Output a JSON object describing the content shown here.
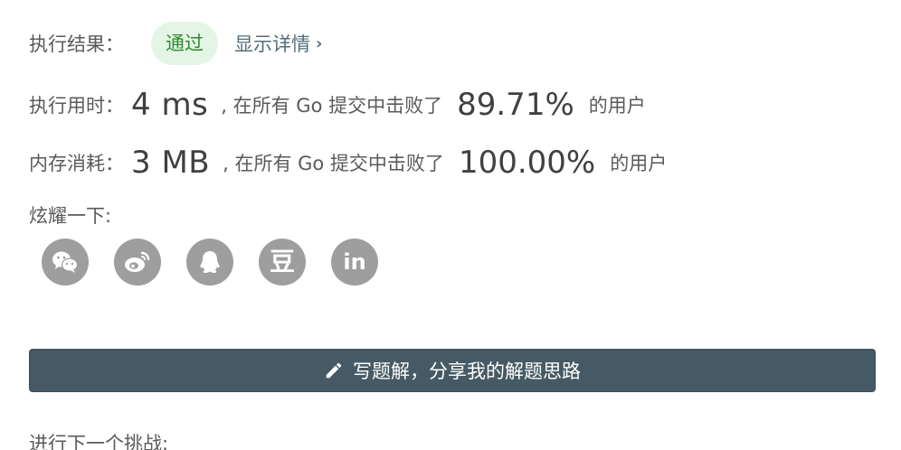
{
  "result": {
    "label": "执行结果：",
    "status": "通过",
    "details_link": "显示详情",
    "details_chevron": "›"
  },
  "runtime": {
    "label": "执行用时：",
    "value": "4 ms",
    "middle": ", 在所有 Go 提交中击败了",
    "percent": "89.71%",
    "tail": "的用户"
  },
  "memory": {
    "label": "内存消耗：",
    "value": "3 MB",
    "middle": ", 在所有 Go 提交中击败了",
    "percent": "100.00%",
    "tail": "的用户"
  },
  "share": {
    "label": "炫耀一下:",
    "icons": [
      "wechat-icon",
      "weibo-icon",
      "qq-icon",
      "douban-icon",
      "linkedin-icon"
    ],
    "douban_glyph": "豆",
    "linkedin_glyph": "in"
  },
  "write_solution": {
    "label": "写题解，分享我的解题思路",
    "icon": "pencil-icon"
  },
  "next_challenge": {
    "label": "进行下一个挑战:"
  },
  "colors": {
    "status_bg": "#e5f5e5",
    "status_text": "#2f8a2f",
    "link": "#546e7a",
    "share_icon_bg": "#9e9e9e",
    "primary_button": "#455a64"
  }
}
